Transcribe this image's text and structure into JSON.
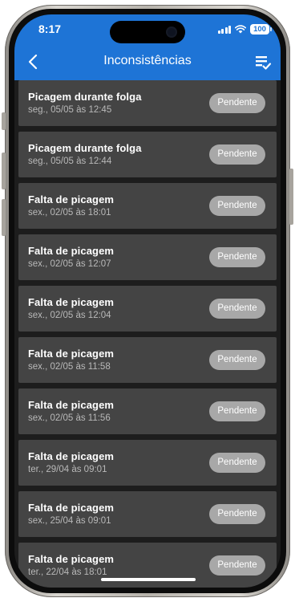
{
  "status_bar": {
    "time": "8:17",
    "battery": "100"
  },
  "header": {
    "title": "Inconsistências"
  },
  "items": [
    {
      "title": "Picagem durante folga",
      "subtitle": "seg., 05/05 às 12:45",
      "status": "Pendente"
    },
    {
      "title": "Picagem durante folga",
      "subtitle": "seg., 05/05 às 12:44",
      "status": "Pendente"
    },
    {
      "title": "Falta de picagem",
      "subtitle": "sex., 02/05 às 18:01",
      "status": "Pendente"
    },
    {
      "title": "Falta de picagem",
      "subtitle": "sex., 02/05 às 12:07",
      "status": "Pendente"
    },
    {
      "title": "Falta de picagem",
      "subtitle": "sex., 02/05 às 12:04",
      "status": "Pendente"
    },
    {
      "title": "Falta de picagem",
      "subtitle": "sex., 02/05 às 11:58",
      "status": "Pendente"
    },
    {
      "title": "Falta de picagem",
      "subtitle": "sex., 02/05 às 11:56",
      "status": "Pendente"
    },
    {
      "title": "Falta de picagem",
      "subtitle": "ter., 29/04 às 09:01",
      "status": "Pendente"
    },
    {
      "title": "Falta de picagem",
      "subtitle": "sex., 25/04 às 09:01",
      "status": "Pendente"
    },
    {
      "title": "Falta de picagem",
      "subtitle": "ter., 22/04 às 18:01",
      "status": "Pendente"
    }
  ],
  "colors": {
    "header": "#1e74d6",
    "background": "#1d1d1d",
    "card": "#444444",
    "badge": "#a8a8a8"
  },
  "icons": {
    "back": "chevron-left-icon",
    "filter": "filter-checklist-icon",
    "signal": "cellular-signal-icon",
    "wifi": "wifi-icon",
    "battery": "battery-icon"
  }
}
